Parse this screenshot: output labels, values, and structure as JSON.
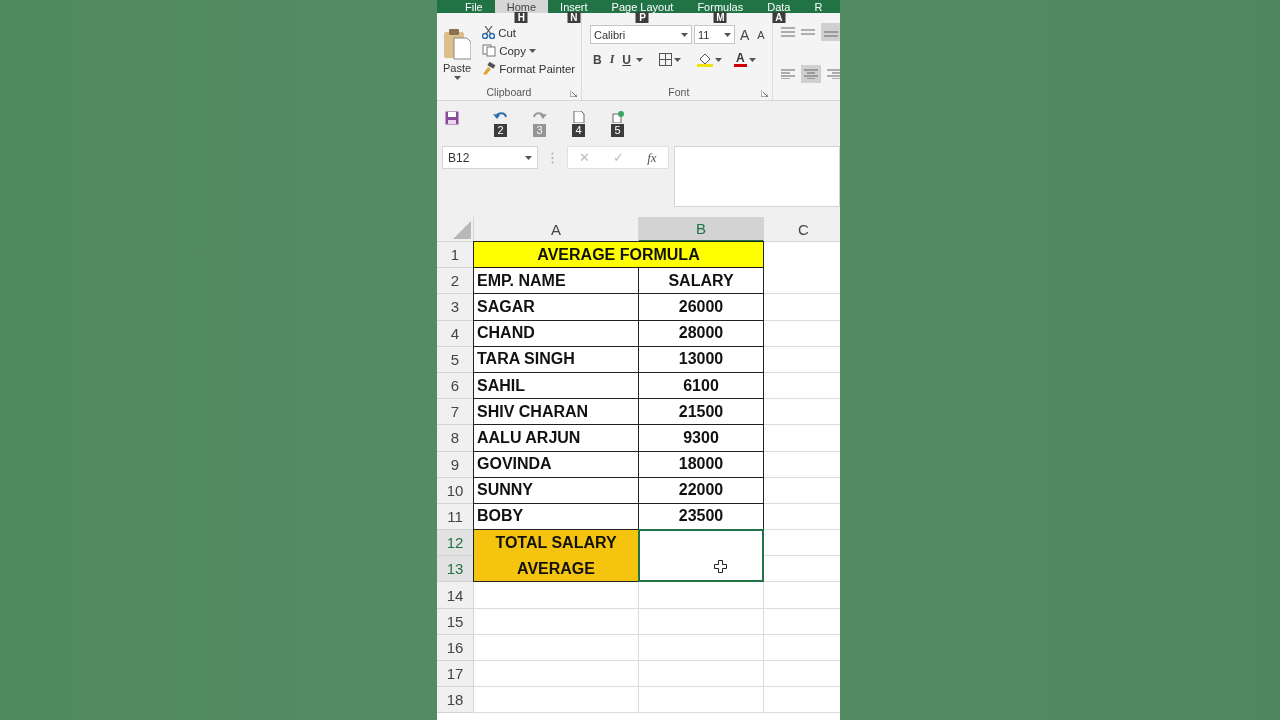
{
  "ribbon_tabs": [
    {
      "label": "File",
      "selected": false
    },
    {
      "label": "Home",
      "selected": true,
      "keytip": "H"
    },
    {
      "label": "Insert",
      "selected": false,
      "keytip": "N"
    },
    {
      "label": "Page Layout",
      "selected": false,
      "keytip": "P"
    },
    {
      "label": "Formulas",
      "selected": false,
      "keytip": "M"
    },
    {
      "label": "Data",
      "selected": false,
      "keytip": "A"
    },
    {
      "label": "R",
      "selected": false
    }
  ],
  "clipboard": {
    "paste": "Paste",
    "cut": "Cut",
    "copy": "Copy",
    "format_painter": "Format Painter",
    "group_label": "Clipboard"
  },
  "font": {
    "font_name": "Calibri",
    "font_size": "11",
    "grow": "A",
    "shrink": "A",
    "bold": "B",
    "italic": "I",
    "underline": "U",
    "font_color": "A",
    "group_label": "Font"
  },
  "quick_access_keytips": [
    "2",
    "3",
    "4",
    "5"
  ],
  "name_box": "B12",
  "formula_buttons": {
    "cancel": "✕",
    "enter": "✓",
    "function": "fx"
  },
  "columns": [
    {
      "label": "A",
      "selected": false
    },
    {
      "label": "B",
      "selected": true
    },
    {
      "label": "C",
      "selected": false
    }
  ],
  "row_numbers": [
    {
      "label": "1",
      "selected": false
    },
    {
      "label": "2",
      "selected": false
    },
    {
      "label": "3",
      "selected": false
    },
    {
      "label": "4",
      "selected": false
    },
    {
      "label": "5",
      "selected": false
    },
    {
      "label": "6",
      "selected": false
    },
    {
      "label": "7",
      "selected": false
    },
    {
      "label": "8",
      "selected": false
    },
    {
      "label": "9",
      "selected": false
    },
    {
      "label": "10",
      "selected": false
    },
    {
      "label": "11",
      "selected": false
    },
    {
      "label": "12",
      "selected": true
    },
    {
      "label": "13",
      "selected": true
    },
    {
      "label": "14",
      "selected": false
    },
    {
      "label": "15",
      "selected": false
    },
    {
      "label": "16",
      "selected": false
    },
    {
      "label": "17",
      "selected": false
    },
    {
      "label": "18",
      "selected": false
    }
  ],
  "sheet": {
    "title": "AVERAGE FORMULA",
    "headers": [
      "EMP. NAME",
      "SALARY"
    ],
    "records": [
      {
        "name": "SAGAR",
        "salary": "26000"
      },
      {
        "name": "CHAND",
        "salary": "28000"
      },
      {
        "name": "TARA SINGH",
        "salary": "13000"
      },
      {
        "name": "SAHIL",
        "salary": "6100"
      },
      {
        "name": "SHIV CHARAN",
        "salary": "21500"
      },
      {
        "name": "AALU ARJUN",
        "salary": "9300"
      },
      {
        "name": "GOVINDA",
        "salary": "18000"
      },
      {
        "name": "SUNNY",
        "salary": "22000"
      },
      {
        "name": "BOBY",
        "salary": "23500"
      }
    ],
    "total_label": "TOTAL SALARY AVERAGE"
  }
}
